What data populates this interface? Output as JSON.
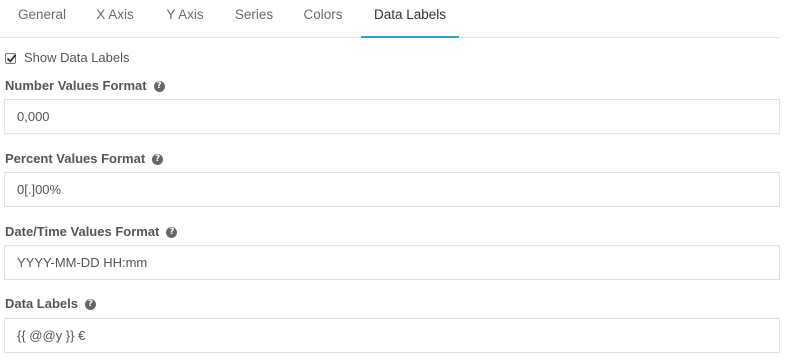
{
  "tabs": [
    {
      "label": "General",
      "active": false
    },
    {
      "label": "X Axis",
      "active": false
    },
    {
      "label": "Y Axis",
      "active": false
    },
    {
      "label": "Series",
      "active": false
    },
    {
      "label": "Colors",
      "active": false
    },
    {
      "label": "Data Labels",
      "active": true
    }
  ],
  "show_data_labels": {
    "label": "Show Data Labels",
    "checked": true
  },
  "fields": {
    "number_format": {
      "label": "Number Values Format",
      "value": "0,000"
    },
    "percent_format": {
      "label": "Percent Values Format",
      "value": "0[.]00%"
    },
    "datetime_format": {
      "label": "Date/Time Values Format",
      "value": "YYYY-MM-DD HH:mm"
    },
    "data_labels": {
      "label": "Data Labels",
      "value": "{{ @@y }} €"
    }
  },
  "help_glyph": "?",
  "colors": {
    "active_tab_underline": "#2a9fd6",
    "help_icon": "#666666"
  }
}
